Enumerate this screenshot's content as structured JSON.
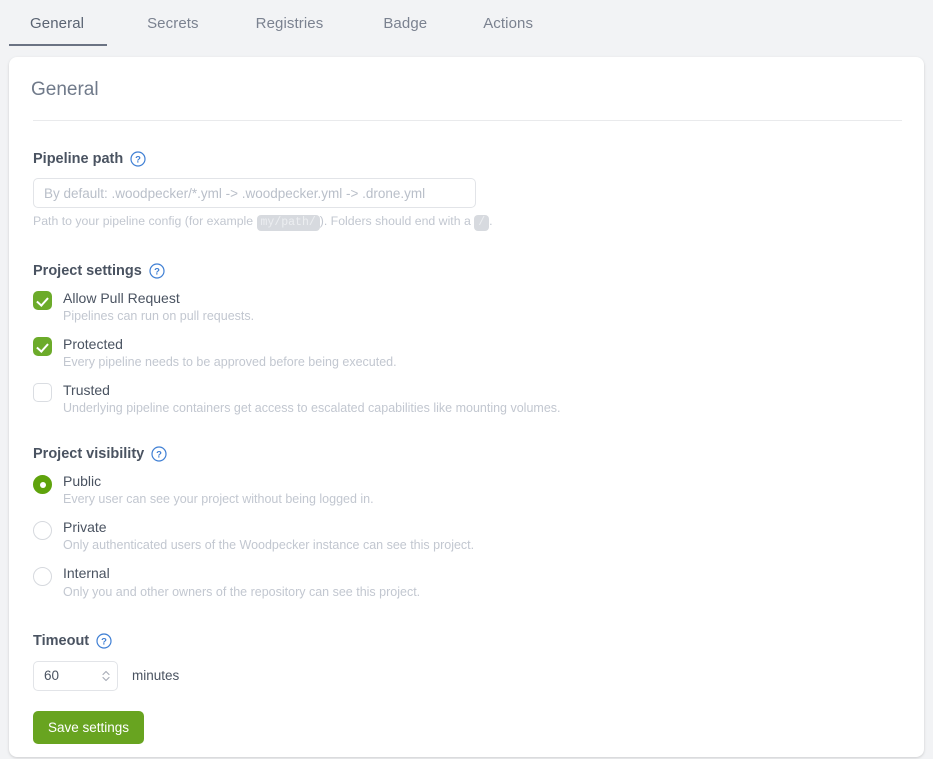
{
  "tabs": [
    {
      "label": "General",
      "active": true
    },
    {
      "label": "Secrets",
      "active": false
    },
    {
      "label": "Registries",
      "active": false
    },
    {
      "label": "Badge",
      "active": false
    },
    {
      "label": "Actions",
      "active": false
    }
  ],
  "card": {
    "title": "General"
  },
  "pipeline_path": {
    "label": "Pipeline path",
    "help_icon": "help-circle-icon",
    "value": "",
    "placeholder": "By default: .woodpecker/*.yml -> .woodpecker.yml -> .drone.yml",
    "hint_prefix": "Path to your pipeline config (for example ",
    "hint_code_1": "my/path/",
    "hint_middle": "). Folders should end with a ",
    "hint_code_2": "/",
    "hint_suffix": "."
  },
  "project_settings": {
    "label": "Project settings",
    "help_icon": "help-circle-icon",
    "options": [
      {
        "name": "allow-pull-request",
        "title": "Allow Pull Request",
        "desc": "Pipelines can run on pull requests.",
        "checked": true
      },
      {
        "name": "protected",
        "title": "Protected",
        "desc": "Every pipeline needs to be approved before being executed.",
        "checked": true
      },
      {
        "name": "trusted",
        "title": "Trusted",
        "desc": "Underlying pipeline containers get access to escalated capabilities like mounting volumes.",
        "checked": false
      }
    ]
  },
  "project_visibility": {
    "label": "Project visibility",
    "help_icon": "help-circle-icon",
    "options": [
      {
        "name": "public",
        "title": "Public",
        "desc": "Every user can see your project without being logged in.",
        "selected": true
      },
      {
        "name": "private",
        "title": "Private",
        "desc": "Only authenticated users of the Woodpecker instance can see this project.",
        "selected": false
      },
      {
        "name": "internal",
        "title": "Internal",
        "desc": "Only you and other owners of the repository can see this project.",
        "selected": false
      }
    ]
  },
  "timeout": {
    "label": "Timeout",
    "help_icon": "help-circle-icon",
    "value": "60",
    "unit_label": "minutes",
    "spinner_icon": "spinner-up-down-icon"
  },
  "save": {
    "label": "Save settings"
  },
  "colors": {
    "page_background": "#f2f3f5",
    "card_background": "#ffffff",
    "accent_green": "#68a420",
    "checkbox_green": "#6cab2a",
    "radio_green": "#5fa30c",
    "help_blue": "#3f7fd4",
    "text_primary": "#4a5361",
    "text_muted": "#c2c7d0",
    "tab_inactive": "#7b8290",
    "tab_active_underline": "#6b7383"
  }
}
